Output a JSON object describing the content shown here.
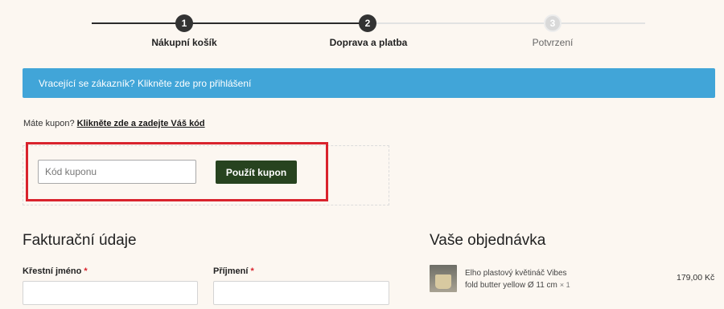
{
  "stepper": {
    "steps": [
      {
        "number": "1",
        "label": "Nákupní košík",
        "state": "done"
      },
      {
        "number": "2",
        "label": "Doprava a platba",
        "state": "done"
      },
      {
        "number": "3",
        "label": "Potvrzení",
        "state": "todo"
      }
    ]
  },
  "banner": {
    "text": "Vracející se zákazník? Klikněte zde pro přihlášení",
    "color": "#41a5d8"
  },
  "coupon": {
    "prompt": "Máte kupon?",
    "link_text": "Klikněte zde a zadejte Váš kód",
    "input_placeholder": "Kód kuponu",
    "input_value": "",
    "button_label": "Použít kupon",
    "button_color": "#27431f",
    "highlight_color": "#d9232d"
  },
  "billing": {
    "title": "Fakturační údaje",
    "fields": [
      {
        "label": "Křestní jméno",
        "required_mark": "*",
        "value": ""
      },
      {
        "label": "Příjmení",
        "required_mark": "*",
        "value": ""
      }
    ]
  },
  "order": {
    "title": "Vaše objednávka",
    "items": [
      {
        "name_line1": "Elho plastový květináč Vibes",
        "name_line2": "fold butter yellow Ø 11 cm",
        "quantity": "× 1",
        "price": "179,00 Kč",
        "thumbnail_icon": "flower-pot-image"
      }
    ]
  }
}
